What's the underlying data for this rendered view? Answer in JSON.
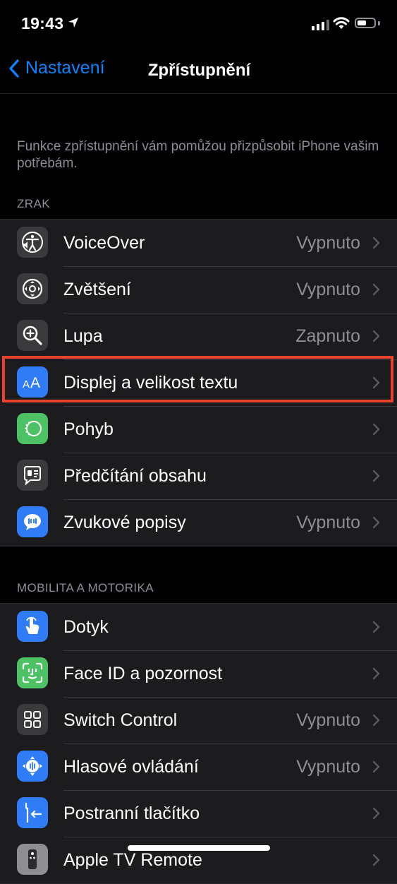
{
  "status_bar": {
    "time": "19:43"
  },
  "nav": {
    "back_label": "Nastavení",
    "title": "Zpřístupnění"
  },
  "intro_text": "Funkce zpřístupnění vám pomůžou přizpůsobit iPhone vašim potřebám.",
  "sections": [
    {
      "header": "ZRAK",
      "items": [
        {
          "label": "VoiceOver",
          "value": "Vypnuto",
          "icon": "voiceover-icon",
          "icon_bg": "#3a3a3c"
        },
        {
          "label": "Zvětšení",
          "value": "Vypnuto",
          "icon": "zoom-icon",
          "icon_bg": "#3a3a3c"
        },
        {
          "label": "Lupa",
          "value": "Zapnuto",
          "icon": "magnifier-icon",
          "icon_bg": "#3a3a3c"
        },
        {
          "label": "Displej a velikost textu",
          "value": "",
          "icon": "text-size-icon",
          "icon_bg": "#2f7cf6",
          "highlighted": true
        },
        {
          "label": "Pohyb",
          "value": "",
          "icon": "motion-icon",
          "icon_bg": "#4cc264"
        },
        {
          "label": "Předčítání obsahu",
          "value": "",
          "icon": "spoken-content-icon",
          "icon_bg": "#3a3a3c"
        },
        {
          "label": "Zvukové popisy",
          "value": "Vypnuto",
          "icon": "audio-description-icon",
          "icon_bg": "#2f7cf6"
        }
      ]
    },
    {
      "header": "MOBILITA A MOTORIKA",
      "items": [
        {
          "label": "Dotyk",
          "value": "",
          "icon": "touch-icon",
          "icon_bg": "#2f7cf6"
        },
        {
          "label": "Face ID a pozornost",
          "value": "",
          "icon": "face-id-icon",
          "icon_bg": "#4cc264"
        },
        {
          "label": "Switch Control",
          "value": "Vypnuto",
          "icon": "switch-control-icon",
          "icon_bg": "#3a3a3c"
        },
        {
          "label": "Hlasové ovládání",
          "value": "Vypnuto",
          "icon": "voice-control-icon",
          "icon_bg": "#2f7cf6"
        },
        {
          "label": "Postranní tlačítko",
          "value": "",
          "icon": "side-button-icon",
          "icon_bg": "#2f7cf6"
        },
        {
          "label": "Apple TV Remote",
          "value": "",
          "icon": "remote-icon",
          "icon_bg": "#8e8e93"
        }
      ]
    }
  ],
  "colors": {
    "accent": "#0a84ff",
    "highlight": "#e8412e",
    "background": "#000000",
    "cell": "#1c1c1e"
  }
}
